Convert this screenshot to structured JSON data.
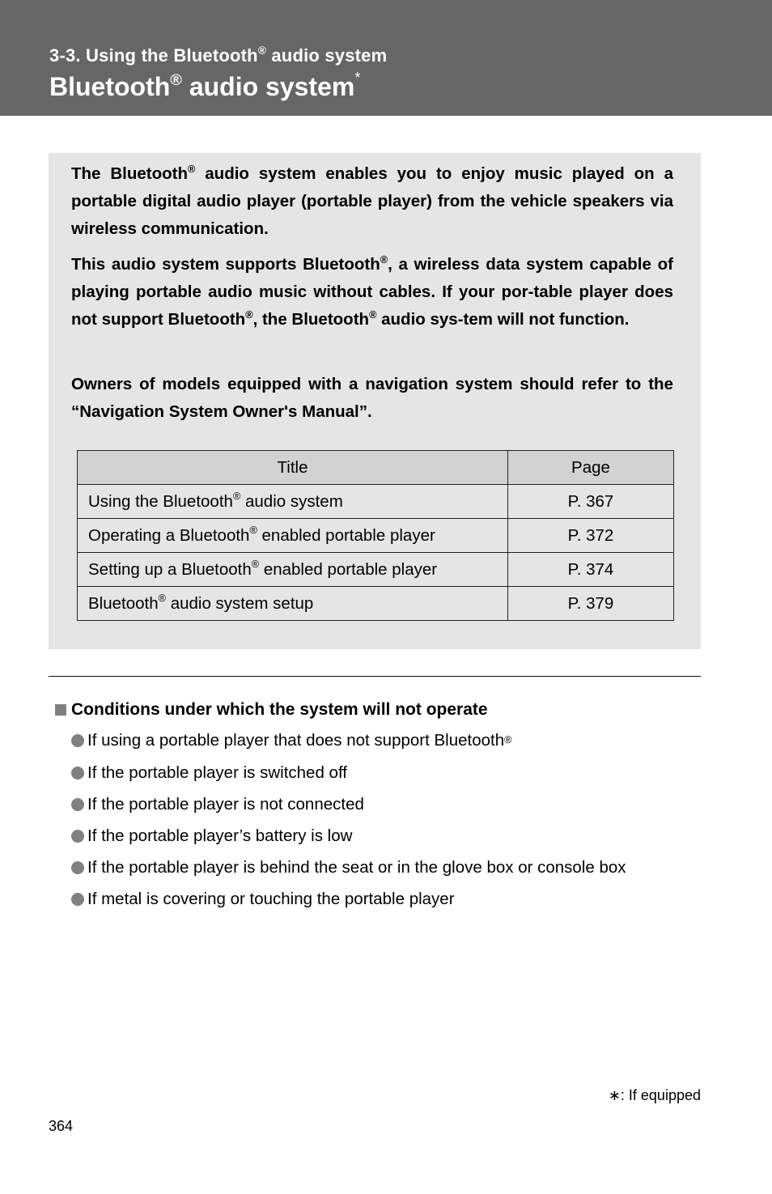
{
  "header": {
    "section_prefix": "3-3. Using the Bluetooth",
    "section_suffix": " audio system",
    "title_prefix": "Bluetooth",
    "title_suffix": " audio system",
    "title_marker": "*",
    "reg": "®"
  },
  "intro": {
    "p1": [
      "The Bluetooth",
      " audio system enables you to enjoy music played on a portable digital audio player (portable player) from the vehicle speakers via wireless communication."
    ],
    "p2": [
      "This audio system supports Bluetooth",
      ", a wireless data system capable of playing portable audio music without cables. If your por-table player does not support Bluetooth",
      ", the Bluetooth",
      " audio sys-tem will not function."
    ],
    "p3": "Owners of models equipped with a navigation system should refer to the “Navigation System Owner's Manual”."
  },
  "toc": {
    "headers": [
      "Title",
      "Page"
    ],
    "rows": [
      {
        "title_pre": "Using the Bluetooth",
        "title_post": " audio system",
        "page": "P. 367"
      },
      {
        "title_pre": "Operating a Bluetooth",
        "title_post": " enabled portable player",
        "page": "P. 372"
      },
      {
        "title_pre": "Setting up a Bluetooth",
        "title_post": " enabled portable player",
        "page": "P. 374"
      },
      {
        "title_pre": "Bluetooth",
        "title_post": " audio system setup",
        "page": "P. 379"
      }
    ]
  },
  "conditions": {
    "heading": "Conditions under which the system will not operate",
    "items": [
      "If using a portable player that does not support Bluetooth",
      "If the portable player is switched off",
      "If the portable player is not connected",
      "If the portable player’s battery is low",
      "If the portable player is behind the seat or in the glove box or console box",
      "If metal is covering or touching the portable player"
    ]
  },
  "footer": {
    "footnote_marker": "∗",
    "footnote_text": ": If equipped",
    "page_number": "364"
  },
  "colors": {
    "header_bg": "#666666",
    "box_bg": "#e5e5e5",
    "table_header_bg": "#d2d2d2",
    "bullet": "#808080"
  }
}
